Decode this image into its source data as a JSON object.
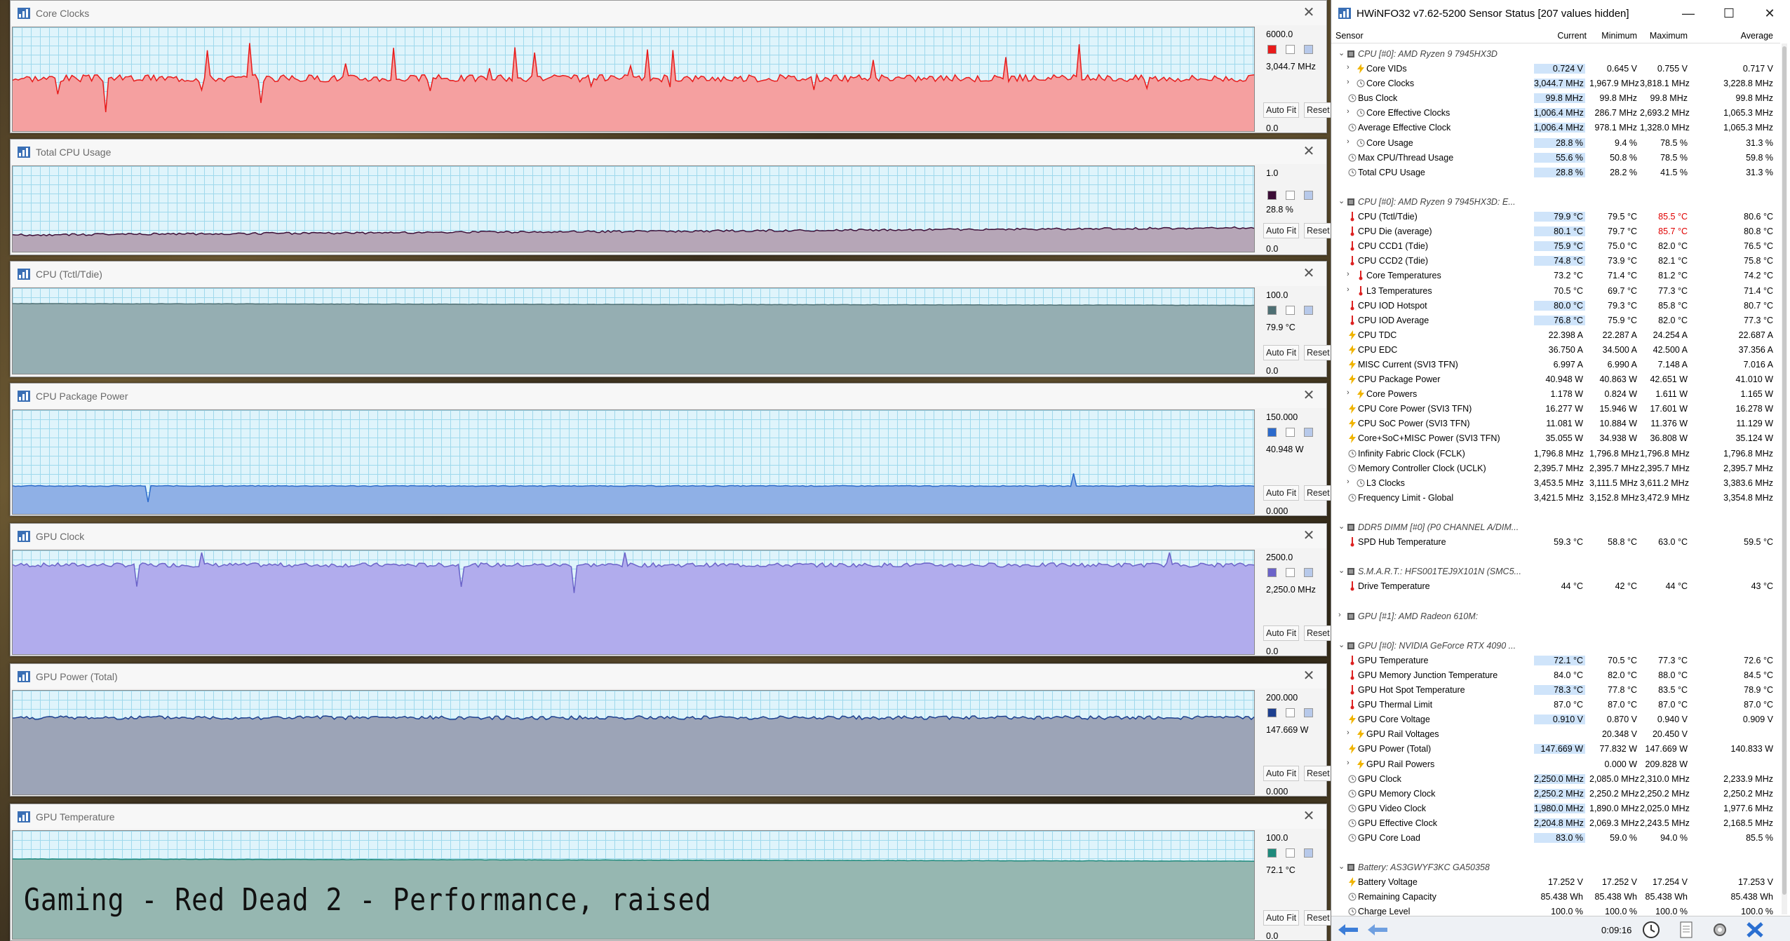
{
  "graphs": [
    {
      "title": "Core Clocks",
      "max": "6000.0",
      "current": "3,044.7 MHz",
      "min": "0.0",
      "color": "#e81b1b",
      "fill": "#f5a0a0",
      "level": 0.51,
      "noise": 0.035,
      "spikes": 0.04
    },
    {
      "title": "Total CPU Usage",
      "max": "1.0",
      "current": "28.8 %",
      "min": "0.0",
      "color": "#3b0d36",
      "fill": "#b6a6b7",
      "level": 0.28,
      "noise": 0.012,
      "spikes": 0.005
    },
    {
      "title": "CPU (Tctl/Tdie)",
      "max": "100.0",
      "current": "79.9 °C",
      "min": "0.0",
      "color": "#4e6f73",
      "fill": "#95aeb2",
      "level": 0.8,
      "noise": 0.004,
      "spikes": 0
    },
    {
      "title": "CPU Package Power",
      "max": "150.000",
      "current": "40.948 W",
      "min": "0.000",
      "color": "#2b6acc",
      "fill": "#8fb0e6",
      "level": 0.27,
      "noise": 0.004,
      "spikes": 0.002
    },
    {
      "title": "GPU Clock",
      "max": "2500.0",
      "current": "2,250.0 MHz",
      "min": "0.0",
      "color": "#6b63c9",
      "fill": "#b1aced",
      "level": 0.86,
      "noise": 0.02,
      "spikes": 0.01
    },
    {
      "title": "GPU Power (Total)",
      "max": "200.000",
      "current": "147.669 W",
      "min": "0.000",
      "color": "#1d3f8f",
      "fill": "#9ca4b7",
      "level": 0.74,
      "noise": 0.018,
      "spikes": 0.01
    },
    {
      "title": "GPU Temperature",
      "max": "100.0",
      "current": "72.1 °C",
      "min": "0.0",
      "color": "#1e8a7c",
      "fill": "#96b7b1",
      "level": 0.72,
      "noise": 0.003,
      "spikes": 0
    }
  ],
  "graph_buttons": {
    "autofit": "Auto Fit",
    "reset": "Reset"
  },
  "caption": "Gaming - Red Dead 2 - Performance, raised",
  "sensor_window": {
    "title": "HWiNFO32 v7.62-5200 Sensor Status [207 values hidden]",
    "headers": {
      "sensor": "Sensor",
      "current": "Current",
      "minimum": "Minimum",
      "maximum": "Maximum",
      "average": "Average"
    },
    "elapsed": "0:09:16"
  },
  "rows": [
    {
      "group": true,
      "name": "CPU [#0]: AMD Ryzen 9 7945HX3D",
      "open": true
    },
    {
      "name": "Core VIDs",
      "icon": "bolt",
      "exp": true,
      "cur": "0.724 V",
      "hl": true,
      "min": "0.645 V",
      "max": "0.755 V",
      "avg": "0.717 V"
    },
    {
      "name": "Core Clocks",
      "icon": "clock",
      "exp": true,
      "cur": "3,044.7 MHz",
      "hl": true,
      "min": "1,967.9 MHz",
      "max": "3,818.1 MHz",
      "avg": "3,228.8 MHz"
    },
    {
      "name": "Bus Clock",
      "icon": "clock",
      "cur": "99.8 MHz",
      "hl": true,
      "min": "99.8 MHz",
      "max": "99.8 MHz",
      "avg": "99.8 MHz"
    },
    {
      "name": "Core Effective Clocks",
      "icon": "clock",
      "exp": true,
      "cur": "1,006.4 MHz",
      "hl": true,
      "min": "286.7 MHz",
      "max": "2,693.2 MHz",
      "avg": "1,065.3 MHz"
    },
    {
      "name": "Average Effective Clock",
      "icon": "clock",
      "cur": "1,006.4 MHz",
      "hl": true,
      "min": "978.1 MHz",
      "max": "1,328.0 MHz",
      "avg": "1,065.3 MHz"
    },
    {
      "name": "Core Usage",
      "icon": "clock",
      "exp": true,
      "cur": "28.8 %",
      "hl": true,
      "min": "9.4 %",
      "max": "78.5 %",
      "avg": "31.3 %"
    },
    {
      "name": "Max CPU/Thread Usage",
      "icon": "clock",
      "cur": "55.6 %",
      "hl": true,
      "min": "50.8 %",
      "max": "78.5 %",
      "avg": "59.8 %"
    },
    {
      "name": "Total CPU Usage",
      "icon": "clock",
      "cur": "28.8 %",
      "hl": true,
      "min": "28.2 %",
      "max": "41.5 %",
      "avg": "31.3 %"
    },
    {
      "blank": true
    },
    {
      "group": true,
      "name": "CPU [#0]: AMD Ryzen 9 7945HX3D: E...",
      "open": true
    },
    {
      "name": "CPU (Tctl/Tdie)",
      "icon": "therm",
      "cur": "79.9 °C",
      "hl": true,
      "min": "79.5 °C",
      "max": "85.5 °C",
      "maxRed": true,
      "avg": "80.6 °C"
    },
    {
      "name": "CPU Die (average)",
      "icon": "therm",
      "cur": "80.1 °C",
      "hl": true,
      "min": "79.7 °C",
      "max": "85.7 °C",
      "maxRed": true,
      "avg": "80.8 °C"
    },
    {
      "name": "CPU CCD1 (Tdie)",
      "icon": "therm",
      "cur": "75.9 °C",
      "hl": true,
      "min": "75.0 °C",
      "max": "82.0 °C",
      "avg": "76.5 °C"
    },
    {
      "name": "CPU CCD2 (Tdie)",
      "icon": "therm",
      "cur": "74.8 °C",
      "hl": true,
      "min": "73.9 °C",
      "max": "82.1 °C",
      "avg": "75.8 °C"
    },
    {
      "name": "Core Temperatures",
      "icon": "therm",
      "exp": true,
      "cur": "73.2 °C",
      "min": "71.4 °C",
      "max": "81.2 °C",
      "avg": "74.2 °C"
    },
    {
      "name": "L3 Temperatures",
      "icon": "therm",
      "exp": true,
      "cur": "70.5 °C",
      "min": "69.7 °C",
      "max": "77.3 °C",
      "avg": "71.4 °C"
    },
    {
      "name": "CPU IOD Hotspot",
      "icon": "therm",
      "cur": "80.0 °C",
      "hl": true,
      "min": "79.3 °C",
      "max": "85.8 °C",
      "avg": "80.7 °C"
    },
    {
      "name": "CPU IOD Average",
      "icon": "therm",
      "cur": "76.8 °C",
      "hl": true,
      "min": "75.9 °C",
      "max": "82.0 °C",
      "avg": "77.3 °C"
    },
    {
      "name": "CPU TDC",
      "icon": "bolt",
      "cur": "22.398 A",
      "min": "22.287 A",
      "max": "24.254 A",
      "avg": "22.687 A"
    },
    {
      "name": "CPU EDC",
      "icon": "bolt",
      "cur": "36.750 A",
      "min": "34.500 A",
      "max": "42.500 A",
      "avg": "37.356 A"
    },
    {
      "name": "MISC Current (SVI3 TFN)",
      "icon": "bolt",
      "cur": "6.997 A",
      "min": "6.990 A",
      "max": "7.148 A",
      "avg": "7.016 A"
    },
    {
      "name": "CPU Package Power",
      "icon": "bolt",
      "cur": "40.948 W",
      "min": "40.863 W",
      "max": "42.651 W",
      "avg": "41.010 W"
    },
    {
      "name": "Core Powers",
      "icon": "bolt",
      "exp": true,
      "cur": "1.178 W",
      "min": "0.824 W",
      "max": "1.611 W",
      "avg": "1.165 W"
    },
    {
      "name": "CPU Core Power (SVI3 TFN)",
      "icon": "bolt",
      "cur": "16.277 W",
      "min": "15.946 W",
      "max": "17.601 W",
      "avg": "16.278 W"
    },
    {
      "name": "CPU SoC Power (SVI3 TFN)",
      "icon": "bolt",
      "cur": "11.081 W",
      "min": "10.884 W",
      "max": "11.376 W",
      "avg": "11.129 W"
    },
    {
      "name": "Core+SoC+MISC Power (SVI3 TFN)",
      "icon": "bolt",
      "cur": "35.055 W",
      "min": "34.938 W",
      "max": "36.808 W",
      "avg": "35.124 W"
    },
    {
      "name": "Infinity Fabric Clock (FCLK)",
      "icon": "clock",
      "cur": "1,796.8 MHz",
      "min": "1,796.8 MHz",
      "max": "1,796.8 MHz",
      "avg": "1,796.8 MHz"
    },
    {
      "name": "Memory Controller Clock (UCLK)",
      "icon": "clock",
      "cur": "2,395.7 MHz",
      "min": "2,395.7 MHz",
      "max": "2,395.7 MHz",
      "avg": "2,395.7 MHz"
    },
    {
      "name": "L3 Clocks",
      "icon": "clock",
      "exp": true,
      "cur": "3,453.5 MHz",
      "min": "3,111.5 MHz",
      "max": "3,611.2 MHz",
      "avg": "3,383.6 MHz"
    },
    {
      "name": "Frequency Limit - Global",
      "icon": "clock",
      "cur": "3,421.5 MHz",
      "min": "3,152.8 MHz",
      "max": "3,472.9 MHz",
      "avg": "3,354.8 MHz"
    },
    {
      "blank": true
    },
    {
      "group": true,
      "name": "DDR5 DIMM [#0] (P0 CHANNEL A/DIM...",
      "open": true
    },
    {
      "name": "SPD Hub Temperature",
      "icon": "therm",
      "cur": "59.3 °C",
      "min": "58.8 °C",
      "max": "63.0 °C",
      "avg": "59.5 °C"
    },
    {
      "blank": true
    },
    {
      "group": true,
      "name": "S.M.A.R.T.: HFS001TEJ9X101N (SMC5...",
      "open": true
    },
    {
      "name": "Drive Temperature",
      "icon": "therm",
      "cur": "44 °C",
      "min": "42 °C",
      "max": "44 °C",
      "avg": "43 °C"
    },
    {
      "blank": true
    },
    {
      "group": true,
      "name": "GPU [#1]: AMD Radeon 610M:",
      "open": false
    },
    {
      "blank": true
    },
    {
      "group": true,
      "name": "GPU [#0]: NVIDIA GeForce RTX 4090 ...",
      "open": true
    },
    {
      "name": "GPU Temperature",
      "icon": "therm",
      "cur": "72.1 °C",
      "hl": true,
      "min": "70.5 °C",
      "max": "77.3 °C",
      "avg": "72.6 °C"
    },
    {
      "name": "GPU Memory Junction Temperature",
      "icon": "therm",
      "cur": "84.0 °C",
      "min": "82.0 °C",
      "max": "88.0 °C",
      "avg": "84.5 °C"
    },
    {
      "name": "GPU Hot Spot Temperature",
      "icon": "therm",
      "cur": "78.3 °C",
      "hl": true,
      "min": "77.8 °C",
      "max": "83.5 °C",
      "avg": "78.9 °C"
    },
    {
      "name": "GPU Thermal Limit",
      "icon": "therm",
      "cur": "87.0 °C",
      "min": "87.0 °C",
      "max": "87.0 °C",
      "avg": "87.0 °C"
    },
    {
      "name": "GPU Core Voltage",
      "icon": "bolt",
      "cur": "0.910 V",
      "hl": true,
      "min": "0.870 V",
      "max": "0.940 V",
      "avg": "0.909 V"
    },
    {
      "name": "GPU Rail Voltages",
      "icon": "bolt",
      "exp": true,
      "cur": "",
      "min": "20.348 V",
      "max": "20.450 V",
      "avg": ""
    },
    {
      "name": "GPU Power (Total)",
      "icon": "bolt",
      "cur": "147.669 W",
      "hl": true,
      "min": "77.832 W",
      "max": "147.669 W",
      "avg": "140.833 W"
    },
    {
      "name": "GPU Rail Powers",
      "icon": "bolt",
      "exp": true,
      "cur": "",
      "min": "0.000 W",
      "max": "209.828 W",
      "avg": ""
    },
    {
      "name": "GPU Clock",
      "icon": "clock",
      "cur": "2,250.0 MHz",
      "hl": true,
      "min": "2,085.0 MHz",
      "max": "2,310.0 MHz",
      "avg": "2,233.9 MHz"
    },
    {
      "name": "GPU Memory Clock",
      "icon": "clock",
      "cur": "2,250.2 MHz",
      "hl": true,
      "min": "2,250.2 MHz",
      "max": "2,250.2 MHz",
      "avg": "2,250.2 MHz"
    },
    {
      "name": "GPU Video Clock",
      "icon": "clock",
      "cur": "1,980.0 MHz",
      "hl": true,
      "min": "1,890.0 MHz",
      "max": "2,025.0 MHz",
      "avg": "1,977.6 MHz"
    },
    {
      "name": "GPU Effective Clock",
      "icon": "clock",
      "cur": "2,204.8 MHz",
      "hl": true,
      "min": "2,069.3 MHz",
      "max": "2,243.5 MHz",
      "avg": "2,168.5 MHz"
    },
    {
      "name": "GPU Core Load",
      "icon": "clock",
      "cur": "83.0 %",
      "hl": true,
      "min": "59.0 %",
      "max": "94.0 %",
      "avg": "85.5 %"
    },
    {
      "blank": true
    },
    {
      "group": true,
      "name": "Battery: AS3GWYF3KC GA50358",
      "open": true
    },
    {
      "name": "Battery Voltage",
      "icon": "bolt",
      "cur": "17.252 V",
      "min": "17.252 V",
      "max": "17.254 V",
      "avg": "17.253 V"
    },
    {
      "name": "Remaining Capacity",
      "icon": "clock",
      "cur": "85.438 Wh",
      "min": "85.438 Wh",
      "max": "85.438 Wh",
      "avg": "85.438 Wh"
    },
    {
      "name": "Charge Level",
      "icon": "clock",
      "cur": "100.0 %",
      "min": "100.0 %",
      "max": "100.0 %",
      "avg": "100.0 %"
    }
  ],
  "colors": {
    "highlight": "#cfe4fa",
    "alarm": "#e00000",
    "grid": "#9fd9ec",
    "plot_bg": "#dff4fb"
  }
}
